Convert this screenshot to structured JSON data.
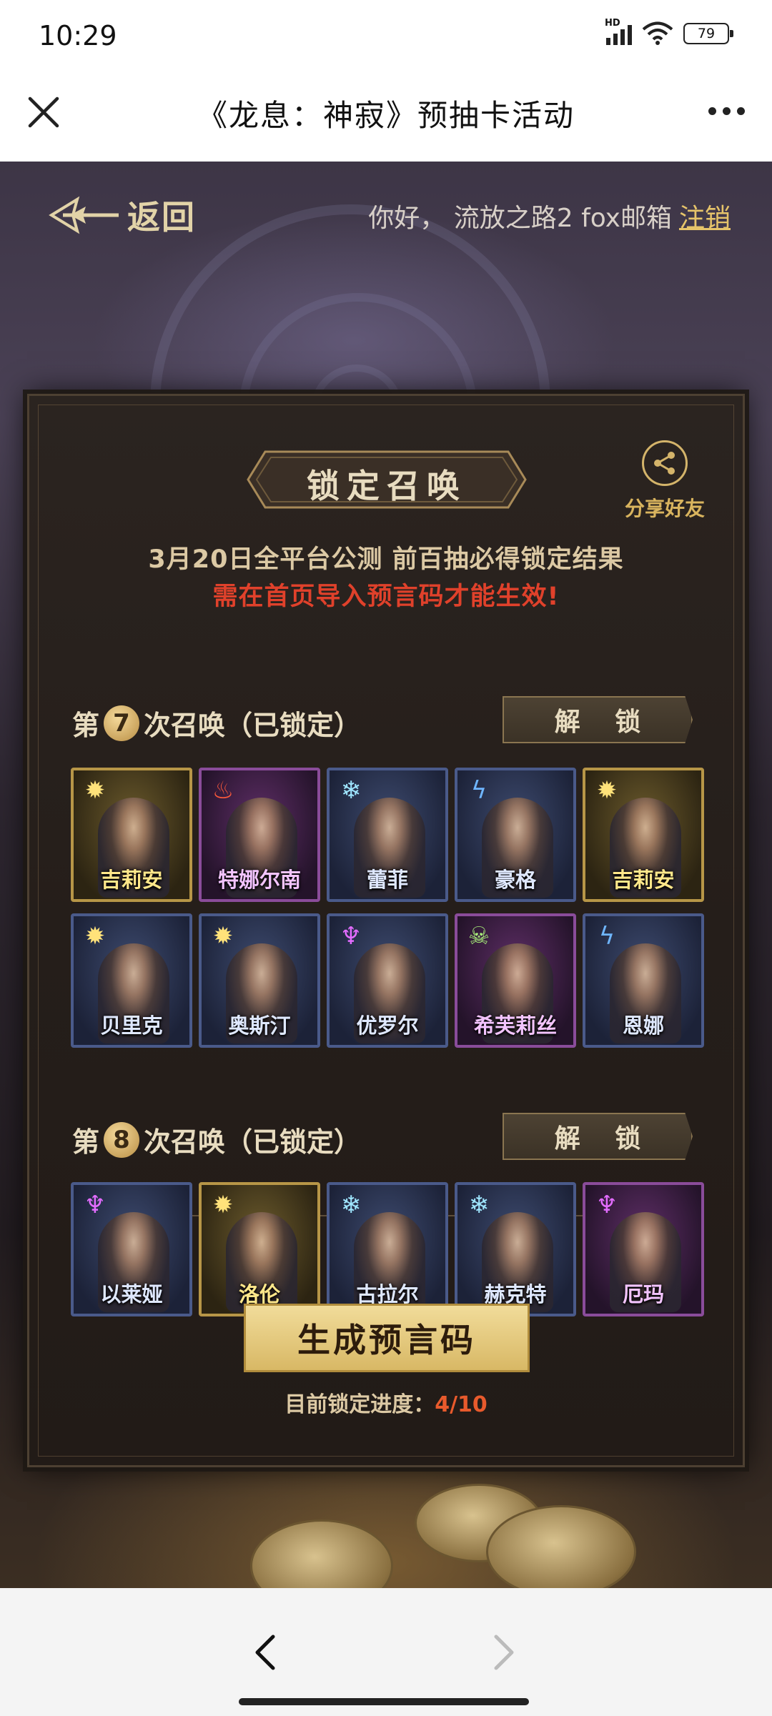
{
  "status": {
    "time": "10:29",
    "network": "HD",
    "battery": "79"
  },
  "titlebar": {
    "title": "《龙息：神寂》预抽卡活动"
  },
  "header": {
    "back_label": "返回",
    "greeting": "你好， 流放之路2 fox邮箱",
    "logout_label": "注销"
  },
  "panel": {
    "title": "锁定召唤",
    "share_label": "分享好友",
    "note": "3月20日全平台公测 前百抽必得锁定结果",
    "warning": "需在首页导入预言码才能生效!",
    "rounds": [
      {
        "prefix": "第",
        "number": "7",
        "suffix": "次召唤（已锁定）",
        "unlock_label": "解 锁",
        "characters": [
          {
            "name": "吉莉安",
            "rarity": "gold",
            "element": "sun-icon"
          },
          {
            "name": "特娜尔南",
            "rarity": "purple",
            "element": "fire-icon"
          },
          {
            "name": "蕾菲",
            "rarity": "blue",
            "element": "frost-icon"
          },
          {
            "name": "豪格",
            "rarity": "blue",
            "element": "lightning-icon"
          },
          {
            "name": "吉莉安",
            "rarity": "gold",
            "element": "sun-icon"
          },
          {
            "name": "贝里克",
            "rarity": "blue",
            "element": "sun-icon"
          },
          {
            "name": "奥斯汀",
            "rarity": "blue",
            "element": "sun-icon"
          },
          {
            "name": "优罗尔",
            "rarity": "blue",
            "element": "demon-icon"
          },
          {
            "name": "希芙莉丝",
            "rarity": "purple",
            "element": "skull-icon"
          },
          {
            "name": "恩娜",
            "rarity": "blue",
            "element": "lightning-icon"
          }
        ]
      },
      {
        "prefix": "第",
        "number": "8",
        "suffix": "次召唤（已锁定）",
        "unlock_label": "解 锁",
        "characters": [
          {
            "name": "以莱娅",
            "rarity": "blue",
            "element": "demon-icon"
          },
          {
            "name": "洛伦",
            "rarity": "gold",
            "element": "sun-icon"
          },
          {
            "name": "古拉尔",
            "rarity": "blue",
            "element": "frost-icon"
          },
          {
            "name": "赫克特",
            "rarity": "blue",
            "element": "frost-icon"
          },
          {
            "name": "厄玛",
            "rarity": "purple",
            "element": "demon-icon"
          }
        ]
      }
    ],
    "generate_label": "生成预言码",
    "progress_label": "目前锁定进度：",
    "progress_value": "4/10"
  },
  "colors": {
    "accent": "#e6c46a",
    "warning": "#e0412b",
    "progress": "#e85a2c"
  }
}
